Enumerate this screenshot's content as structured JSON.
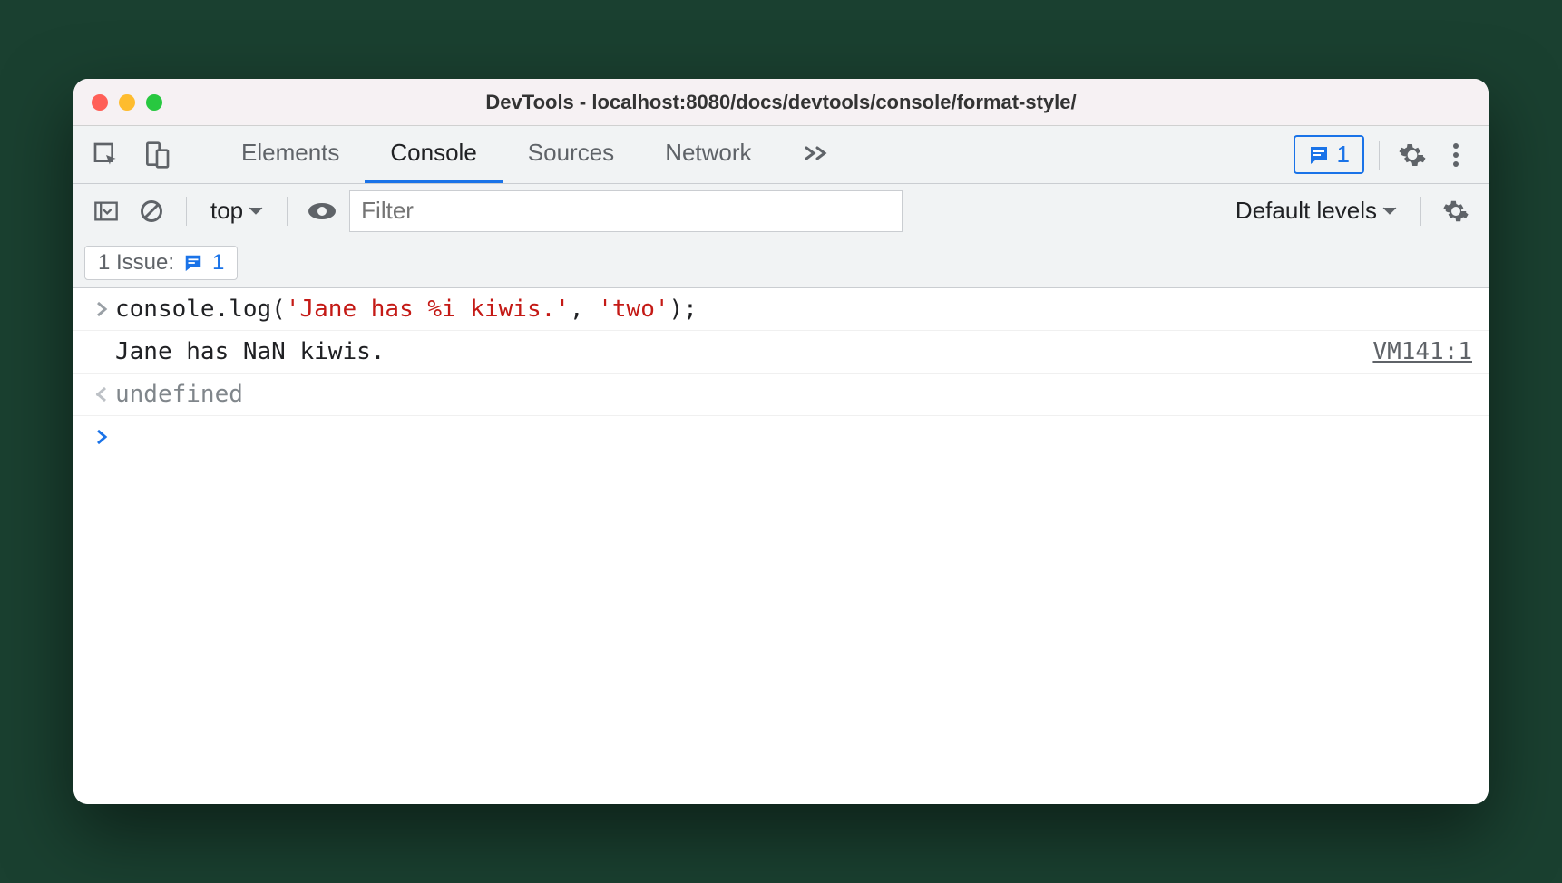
{
  "window": {
    "title": "DevTools - localhost:8080/docs/devtools/console/format-style/"
  },
  "tabs": {
    "elements": "Elements",
    "console": "Console",
    "sources": "Sources",
    "network": "Network"
  },
  "badges": {
    "issues_count": "1"
  },
  "toolbar": {
    "context": "top",
    "filter_placeholder": "Filter",
    "levels": "Default levels"
  },
  "issues": {
    "label": "1 Issue:",
    "count": "1"
  },
  "console": {
    "input_prefix": "console.log(",
    "input_str1": "'Jane has %i kiwis.'",
    "input_sep": ", ",
    "input_str2": "'two'",
    "input_suffix": ");",
    "output": "Jane has NaN kiwis.",
    "src": "VM141:1",
    "return": "undefined"
  }
}
